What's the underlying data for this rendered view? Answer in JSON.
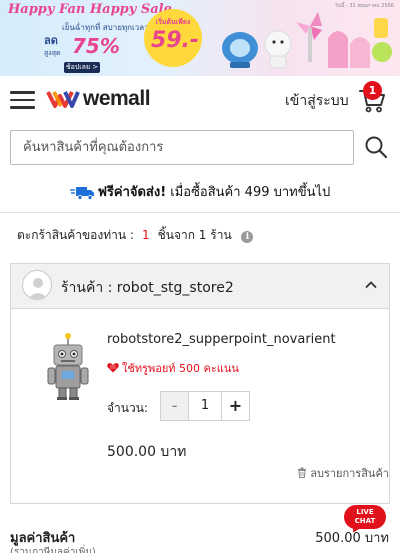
{
  "banner": {
    "title": "Happy Fan Happy Sale",
    "subtitle": "เย็นฉ่ำทุกที่ สบายทุกเวลา",
    "discount_label": "ลด",
    "discount_sublabel": "สูงสุด",
    "discount_value": "75%",
    "shop_button": "ช้อปเลย >",
    "price_caption": "เริ่มต้นเพียง",
    "price_value": "59.-",
    "date_note": "วันนี้ - 31 พฤษภาคม 2566"
  },
  "header": {
    "logo_text": "wemall",
    "login_label": "เข้าสู่ระบบ",
    "cart_count": "1"
  },
  "search": {
    "placeholder": "ค้นหาสินค้าที่คุณต้องการ"
  },
  "shipping": {
    "bold_text": "ฟรีค่าจัดส่ง!",
    "rest_text": " เมื่อซื้อสินค้า 499 บาทขึ้นไป"
  },
  "summary": {
    "prefix": "ตะกร้าสินค้าของท่าน :",
    "count": "1",
    "suffix": "ชิ้นจาก 1 ร้าน"
  },
  "store": {
    "name": "ร้านค้า : robot_stg_store2",
    "item": {
      "name": "robotstore2_supperpoint_novarient",
      "points": "ใช้ทรูพอยท์ 500 คะแนน",
      "qty_label": "จำนวน:",
      "qty": "1",
      "minus": "-",
      "plus": "+",
      "price": "500.00 บาท",
      "remove_label": "ลบรายการสินค้า"
    }
  },
  "total": {
    "label": "มูลค่าสินค้า",
    "value": "500.00 บาท",
    "sub": "(รวมภาษีมูลค่าเพิ่ม)"
  },
  "live_chat": {
    "line1": "LIVE",
    "line2": "CHAT"
  },
  "colors": {
    "accent_red": "#e1111b",
    "banner_pink": "#e8458f",
    "banner_navy": "#1a2b55"
  },
  "icons": [
    "menu-icon",
    "cart-icon",
    "search-icon",
    "truck-icon",
    "info-icon",
    "chevron-up-icon",
    "heart-icon",
    "trash-icon"
  ]
}
